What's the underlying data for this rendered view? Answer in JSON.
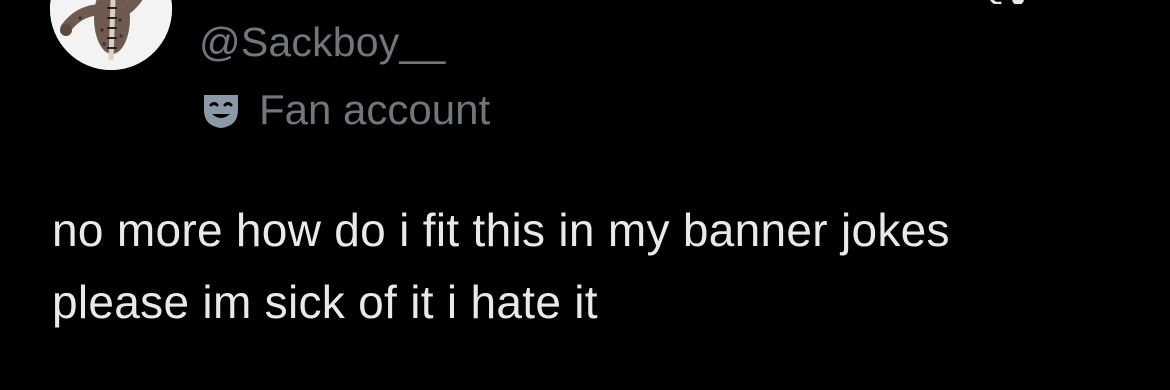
{
  "tweet": {
    "handle": "@Sackboy__",
    "label": {
      "text": "Fan account",
      "icon": "theater-masks-icon"
    },
    "text_lines": [
      "no more how do i fit this in my banner jokes",
      "please im sick of it i hate it"
    ]
  },
  "colors": {
    "background": "#000000",
    "primary_text": "#e7e9ea",
    "secondary_text": "#71767b",
    "icon": "#8b98a5"
  }
}
